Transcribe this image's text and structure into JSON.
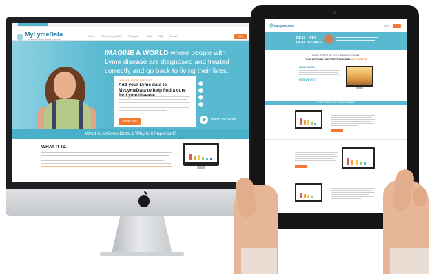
{
  "desktop": {
    "site": {
      "logo": "MyLymeData",
      "tagline": "a patient-powered research platform",
      "nav_items": [
        "Home",
        "What is MyLymeData",
        "Participate",
        "Data",
        "FAQ",
        "Contact"
      ],
      "join_label": "Join",
      "hero": {
        "title_lead": "IMAGINE A WORLD",
        "title_rest": " where people with Lyme disease are diagnosed and treated correctly and go back to living their lives."
      },
      "card": {
        "kicker": "LYMEDISEASE.ORG PRESENTS",
        "title": "Add your Lyme data to MyLymeData to help find a cure for Lyme disease.",
        "donate_label": "Donate Now"
      },
      "watch_label": "Watch the Video",
      "band_title": "What is MyLymeData & Why is it Important?",
      "section_title": "WHAT IT IS."
    }
  },
  "tablet": {
    "site": {
      "logo": "MyLymeData",
      "hero_title_1": "REAL LIVES.",
      "hero_title_2": "REAL STORIES.",
      "intro_1": "LYME DISEASE IS LEARNING FROM",
      "intro_2a": "PEOPLE THAT MATTER THE MOST – ",
      "intro_2b": "PATIENTS",
      "section_1": "WHAT WE DO",
      "section_2": "HOW WE DO IT",
      "band_title": "LYME DISEASE IS OUR NUMBERS"
    }
  },
  "device": {
    "imac_logo_icon": "apple-logo-icon"
  },
  "colors": {
    "brand_blue": "#58b9d1",
    "accent_orange": "#f07a2f"
  }
}
